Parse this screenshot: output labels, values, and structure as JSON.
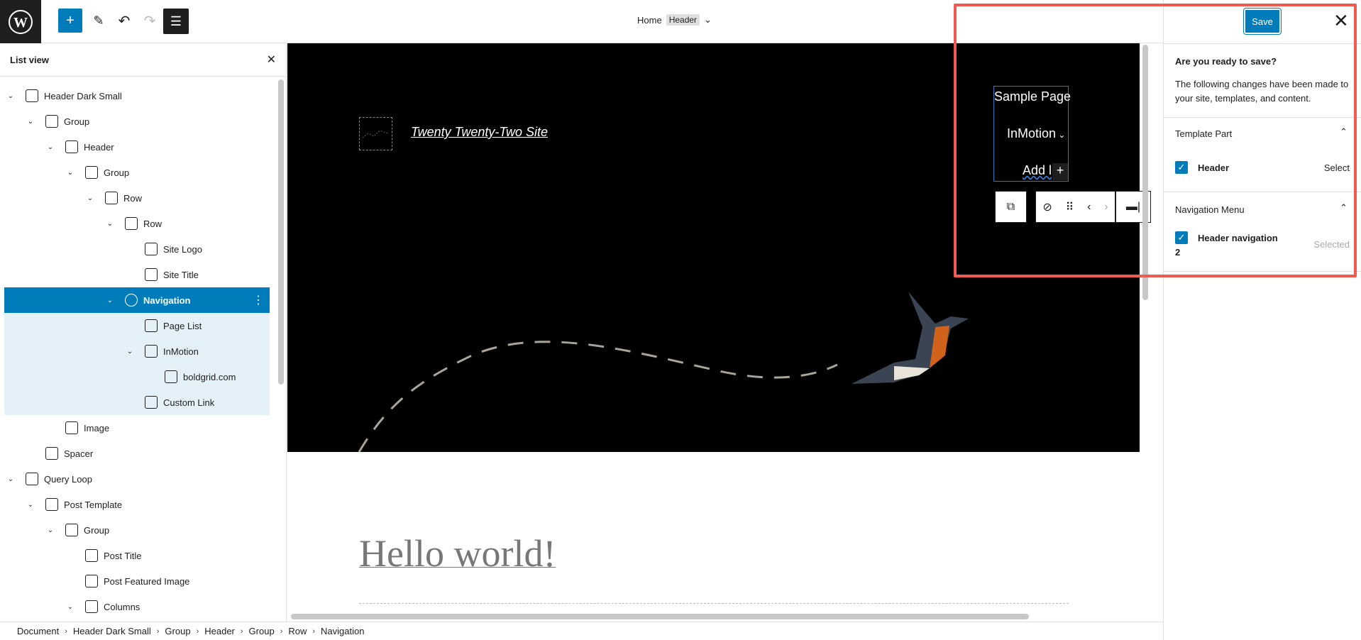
{
  "topbar": {
    "title": "Home",
    "badge": "Header",
    "save_label": "Save"
  },
  "list_view": {
    "title": "List view",
    "items": [
      {
        "label": "Header Dark Small",
        "level": 0,
        "chevron": true
      },
      {
        "label": "Group",
        "level": 1,
        "chevron": true
      },
      {
        "label": "Header",
        "level": 2,
        "chevron": true
      },
      {
        "label": "Group",
        "level": 3,
        "chevron": true
      },
      {
        "label": "Row",
        "level": 4,
        "chevron": true
      },
      {
        "label": "Row",
        "level": 5,
        "chevron": true
      },
      {
        "label": "Site Logo",
        "level": 6,
        "chevron": false
      },
      {
        "label": "Site Title",
        "level": 6,
        "chevron": false
      },
      {
        "label": "Navigation",
        "level": 5,
        "chevron": true,
        "selected": true
      },
      {
        "label": "Page List",
        "level": 6,
        "chevron": false,
        "child": true
      },
      {
        "label": "InMotion",
        "level": 6,
        "chevron": true,
        "child": true
      },
      {
        "label": "boldgrid.com",
        "level": 7,
        "chevron": false,
        "child": true
      },
      {
        "label": "Custom Link",
        "level": 6,
        "chevron": false,
        "child": true
      },
      {
        "label": "Image",
        "level": 2,
        "chevron": false
      },
      {
        "label": "Spacer",
        "level": 1,
        "chevron": false
      },
      {
        "label": "Query Loop",
        "level": 0,
        "chevron": true
      },
      {
        "label": "Post Template",
        "level": 1,
        "chevron": true
      },
      {
        "label": "Group",
        "level": 2,
        "chevron": true
      },
      {
        "label": "Post Title",
        "level": 3,
        "chevron": false
      },
      {
        "label": "Post Featured Image",
        "level": 3,
        "chevron": false
      },
      {
        "label": "Columns",
        "level": 3,
        "chevron": true
      }
    ]
  },
  "canvas": {
    "site_title": "Twenty Twenty-Two Site",
    "nav_items": [
      "Sample Page",
      "InMotion",
      "Add l"
    ],
    "post_title": "Hello world!"
  },
  "breadcrumb": [
    "Document",
    "Header Dark Small",
    "Group",
    "Header",
    "Group",
    "Row",
    "Navigation"
  ],
  "save_panel": {
    "heading": "Are you ready to save?",
    "description": "The following changes have been made to your site, templates, and content.",
    "template_part": {
      "title": "Template Part",
      "item": "Header",
      "action": "Select"
    },
    "navigation_menu": {
      "title": "Navigation Menu",
      "item": "Header navigation",
      "item_suffix": "2",
      "action": "Selected"
    }
  },
  "colors": {
    "accent": "#007cba",
    "annotation": "#ef5b4f"
  }
}
